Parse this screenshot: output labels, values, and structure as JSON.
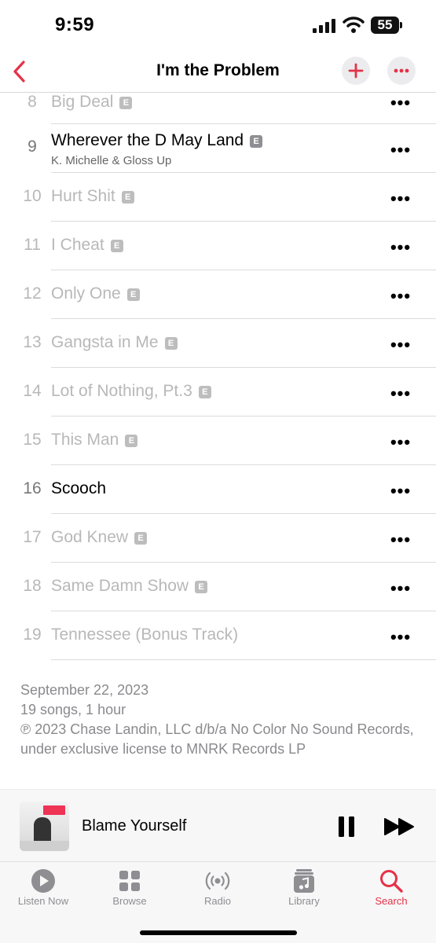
{
  "status": {
    "time": "9:59",
    "battery": "55"
  },
  "nav": {
    "title": "I'm the Problem",
    "back_icon": "chevron-left-icon",
    "add_icon": "plus-icon",
    "more_icon": "ellipsis-icon"
  },
  "explicit_badge": "E",
  "more_glyph": "•••",
  "tracks": [
    {
      "number": "8",
      "title": "Big Deal",
      "explicit": true
    },
    {
      "number": "9",
      "title": "Wherever the D May Land",
      "explicit": true,
      "artist": "K. Michelle & Gloss Up"
    },
    {
      "number": "10",
      "title": "Hurt Shit",
      "explicit": true
    },
    {
      "number": "11",
      "title": "I Cheat",
      "explicit": true
    },
    {
      "number": "12",
      "title": "Only One",
      "explicit": true
    },
    {
      "number": "13",
      "title": "Gangsta in Me",
      "explicit": true
    },
    {
      "number": "14",
      "title": "Lot of Nothing, Pt.3",
      "explicit": true
    },
    {
      "number": "15",
      "title": "This Man",
      "explicit": true
    },
    {
      "number": "16",
      "title": "Scooch",
      "explicit": false
    },
    {
      "number": "17",
      "title": "God Knew",
      "explicit": true
    },
    {
      "number": "18",
      "title": "Same Damn Show",
      "explicit": true
    },
    {
      "number": "19",
      "title": "Tennessee (Bonus Track)",
      "explicit": false
    }
  ],
  "album_info": {
    "release_date": "September 22, 2023",
    "summary": "19 songs, 1 hour",
    "copyright": "℗ 2023 Chase Landin, LLC d/b/a No Color No Sound Records, under exclusive license to MNRK Records LP"
  },
  "now_playing": {
    "title": "Blame Yourself",
    "pause_icon": "pause-icon",
    "forward_icon": "fast-forward-icon"
  },
  "tabs": [
    {
      "label": "Listen Now",
      "icon": "play-circle-icon",
      "selected": false
    },
    {
      "label": "Browse",
      "icon": "grid-icon",
      "selected": false
    },
    {
      "label": "Radio",
      "icon": "radio-waves-icon",
      "selected": false
    },
    {
      "label": "Library",
      "icon": "music-library-icon",
      "selected": false
    },
    {
      "label": "Search",
      "icon": "search-icon",
      "selected": true
    }
  ],
  "colors": {
    "accent": "#e53247",
    "dimmed_text": "#b8b8b8",
    "secondary_text": "#8a8a8e"
  }
}
